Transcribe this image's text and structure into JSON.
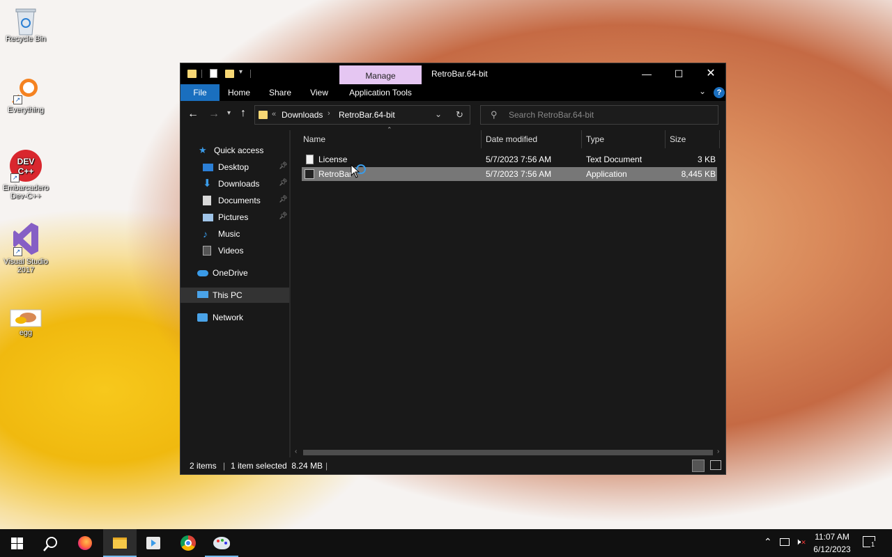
{
  "desktop": {
    "icons": [
      {
        "label": "Recycle Bin"
      },
      {
        "label": "Everything"
      },
      {
        "label": "Embarcadero Dev-C++"
      },
      {
        "label": "Visual Studio 2017"
      },
      {
        "label": "egg"
      }
    ]
  },
  "window": {
    "title": "RetroBar.64-bit",
    "context_tab": "Manage",
    "ribbon_tabs": [
      "File",
      "Home",
      "Share",
      "View",
      "Application Tools"
    ],
    "address": {
      "overflow": "«",
      "segments": [
        "Downloads",
        "RetroBar.64-bit"
      ]
    },
    "search_placeholder": "Search RetroBar.64-bit",
    "nav": {
      "quick_access": "Quick access",
      "items": [
        "Desktop",
        "Downloads",
        "Documents",
        "Pictures",
        "Music",
        "Videos"
      ],
      "onedrive": "OneDrive",
      "this_pc": "This PC",
      "network": "Network"
    },
    "columns": {
      "name": "Name",
      "date": "Date modified",
      "type": "Type",
      "size": "Size"
    },
    "files": [
      {
        "name": "License",
        "date": "5/7/2023 7:56 AM",
        "type": "Text Document",
        "size": "3 KB"
      },
      {
        "name": "RetroBar",
        "date": "5/7/2023 7:56 AM",
        "type": "Application",
        "size": "8,445 KB"
      }
    ],
    "status": {
      "count": "2 items",
      "selection": "1 item selected  8.24 MB"
    }
  },
  "taskbar": {
    "time": "11:07 AM",
    "date": "6/12/2023",
    "notification_count": "1"
  },
  "colors": {
    "accent": "#1a6fbf",
    "manage_tab": "#e5c6f2",
    "selection": "#777777"
  }
}
